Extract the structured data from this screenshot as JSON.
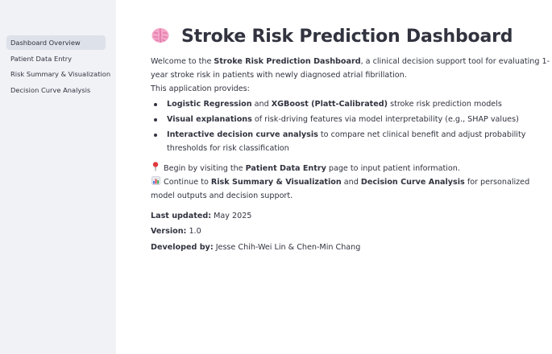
{
  "sidebar": {
    "items": [
      {
        "label": "Dashboard Overview",
        "active": true
      },
      {
        "label": "Patient Data Entry",
        "active": false
      },
      {
        "label": "Risk Summary & Visualization",
        "active": false
      },
      {
        "label": "Decision Curve Analysis",
        "active": false
      }
    ]
  },
  "header": {
    "icon": "brain-icon",
    "title": "Stroke Risk Prediction Dashboard"
  },
  "intro": {
    "welcome_prefix": "Welcome to the ",
    "welcome_bold": "Stroke Risk Prediction Dashboard",
    "welcome_suffix": ", a clinical decision support tool for evaluating 1-year stroke risk in patients with newly diagnosed atrial fibrillation.",
    "provides": "This application provides:"
  },
  "features": [
    {
      "bold1": "Logistic Regression",
      "mid": " and ",
      "bold2": "XGBoost (Platt-Calibrated)",
      "rest": " stroke risk prediction models"
    },
    {
      "bold1": "Visual explanations",
      "mid": "",
      "bold2": "",
      "rest": " of risk-driving features via model interpretability (e.g., SHAP values)"
    },
    {
      "bold1": "Interactive decision curve analysis",
      "mid": "",
      "bold2": "",
      "rest": " to compare net clinical benefit and adjust probability thresholds for risk classification"
    }
  ],
  "tips": {
    "tip1_icon": "pin-icon",
    "tip1_prefix": "Begin by visiting the ",
    "tip1_bold": "Patient Data Entry",
    "tip1_suffix": " page to input patient information.",
    "tip2_icon": "bar-chart-icon",
    "tip2_prefix": "Continue to ",
    "tip2_bold1": "Risk Summary & Visualization",
    "tip2_mid": " and ",
    "tip2_bold2": "Decision Curve Analysis",
    "tip2_suffix": " for personalized model outputs and decision support."
  },
  "meta": {
    "updated_label": "Last updated:",
    "updated_value": " May 2025",
    "version_label": "Version:",
    "version_value": " 1.0",
    "dev_label": "Developed by:",
    "dev_value": " Jesse Chih-Wei Lin & Chen-Min Chang"
  },
  "colors": {
    "sidebar_bg": "#f0f2f6",
    "active_item_bg": "#dde1e9",
    "text": "#31333f"
  }
}
